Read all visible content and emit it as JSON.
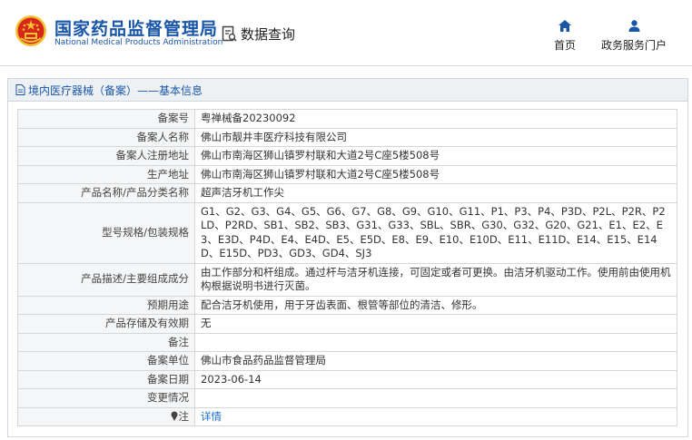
{
  "header": {
    "org_name_cn": "国家药品监督管理局",
    "org_name_en": "National Medical Products Administration",
    "query_label": "数据查询",
    "nav": {
      "home": "首页",
      "portal": "政务服务门户"
    }
  },
  "section": {
    "title": "境内医疗器械（备案）——基本信息"
  },
  "rows": [
    {
      "label": "备案号",
      "value": "粤禅械备20230092"
    },
    {
      "label": "备案人名称",
      "value": "佛山市靓井丰医疗科技有限公司"
    },
    {
      "label": "备案人注册地址",
      "value": "佛山市南海区狮山镇罗村联和大道2号C座5楼508号"
    },
    {
      "label": "生产地址",
      "value": "佛山市南海区狮山镇罗村联和大道2号C座5楼508号"
    },
    {
      "label": "产品名称/产品分类名称",
      "value": "超声洁牙机工作尖"
    },
    {
      "label": "型号规格/包装规格",
      "value": "G1、G2、G3、G4、G5、G6、G7、G8、G9、G10、G11、P1、P3、P4、P3D、P2L、P2R、P2LD、P2RD、SB1、SB2、SB3、G31、G33、SBL、SBR、G30、G32、G20、G21、E1、E2、E3、E3D、P4D、E4、E4D、E5、E5D、E8、E9、E10、E10D、E11、E11D、E14、E15、E14D、E15D、PD3、GD3、GD4、SJ3"
    },
    {
      "label": "产品描述/主要组成成分",
      "value": "由工作部分和杆组成。通过杆与洁牙机连接，可固定或者可更换。由洁牙机驱动工作。使用前由使用机构根据说明书进行灭菌。"
    },
    {
      "label": "预期用途",
      "value": "配合洁牙机使用，用于牙齿表面、根管等部位的清洁、修形。"
    },
    {
      "label": "产品存储及有效期",
      "value": "无"
    },
    {
      "label": "备注",
      "value": ""
    },
    {
      "label": "备案单位",
      "value": "佛山市食品药品监督管理局"
    },
    {
      "label": "备案日期",
      "value": "2023-06-14"
    },
    {
      "label": "变更情况",
      "value": ""
    }
  ],
  "note_row": {
    "label": "注",
    "link": "详情"
  },
  "colors": {
    "brand_blue": "#1a56a8",
    "link_blue": "#1a6fd1",
    "emblem_red": "#d7261c",
    "emblem_gold": "#f2c230"
  },
  "icons": [
    "national-emblem-icon",
    "data-query-icon",
    "home-icon",
    "user-icon",
    "document-icon",
    "pin-icon"
  ]
}
